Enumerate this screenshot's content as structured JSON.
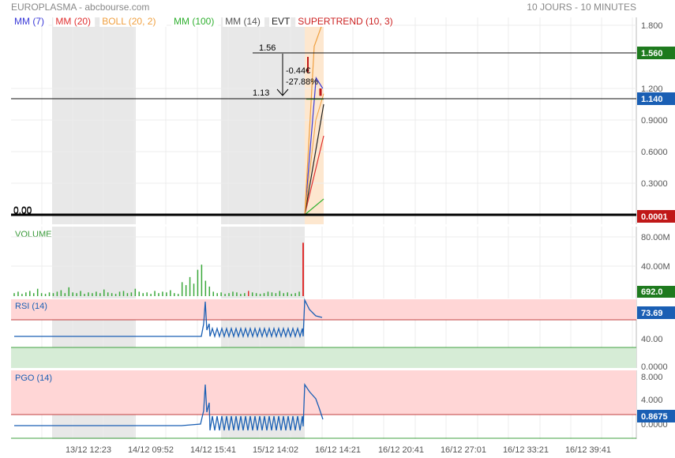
{
  "header": {
    "title": "EUROPLASMA - abcbourse.com",
    "period": "10 JOURS - 10 MINUTES"
  },
  "legend": [
    {
      "label": "MM (7)",
      "color": "#3a3ad8"
    },
    {
      "label": "MM (20)",
      "color": "#e03030"
    },
    {
      "label": "BOLL (20, 2)",
      "color": "#f0a040"
    },
    {
      "label": "MM (100)",
      "color": "#30b030"
    },
    {
      "label": "MM (14)",
      "color": "#555555"
    },
    {
      "label": "EVT",
      "color": "#222222"
    },
    {
      "label": "SUPERTREND (10, 3)",
      "color": "#cc2222"
    }
  ],
  "x_ticks": [
    "13/12 12:23",
    "14/12 09:52",
    "14/12 15:41",
    "15/12 14:02",
    "16/12 14:21",
    "16/12 20:41",
    "16/12 27:01",
    "16/12 33:21",
    "16/12 39:41"
  ],
  "price_panel": {
    "y_ticks": [
      "1.800",
      "1.200",
      "0.9000",
      "0.6000",
      "0.3000"
    ],
    "ylim": [
      0,
      1.8
    ],
    "badges": [
      {
        "label": "1.560",
        "value": 1.56,
        "color": "#1e7a1e"
      },
      {
        "label": "1.140",
        "value": 1.14,
        "color": "#1a5fb4"
      },
      {
        "label": "0.0001",
        "value": 0.0001,
        "color": "#c01818"
      }
    ],
    "annotations": {
      "high_label": "1.56",
      "low_label": "1.13",
      "change_abs": "-0.44€",
      "change_pct": "-27.88%",
      "left_zero_a": "0.00",
      "left_zero_b": "0.00"
    }
  },
  "volume_panel": {
    "label": "VOLUME",
    "y_ticks": [
      "80.00M",
      "40.00M"
    ],
    "badge": {
      "label": "692.0",
      "color": "#1e7a1e"
    }
  },
  "rsi_panel": {
    "label": "RSI (14)",
    "y_ticks": [
      "40.00",
      "0.0000"
    ],
    "badge": {
      "label": "73.69",
      "color": "#1a5fb4"
    }
  },
  "pgo_panel": {
    "label": "PGO (14)",
    "y_ticks": [
      "8.000",
      "4.000",
      "0.0000"
    ],
    "badge": {
      "label": "0.8675",
      "color": "#1a5fb4"
    }
  },
  "chart_data": {
    "type": "line",
    "title": "EUROPLASMA - abcbourse.com",
    "series": [
      {
        "name": "MM (7)",
        "color": "#3a3ad8",
        "points": [
          [
            0,
            0.0
          ],
          [
            0.6,
            1.3
          ],
          [
            0.95,
            1.2
          ]
        ]
      },
      {
        "name": "MM (20)",
        "color": "#e03030",
        "points": [
          [
            0,
            0.0
          ],
          [
            1,
            0.75
          ]
        ]
      },
      {
        "name": "MM (100)",
        "color": "#30b030",
        "points": [
          [
            0,
            0.0
          ],
          [
            1,
            0.15
          ]
        ]
      },
      {
        "name": "MM (14)",
        "color": "#222222",
        "points": [
          [
            0,
            0.0
          ],
          [
            1,
            1.05
          ]
        ]
      },
      {
        "name": "BOLL (20, 2)",
        "color": "#f0a040",
        "points": [
          [
            0,
            0.0
          ],
          [
            0.5,
            1.6
          ],
          [
            1,
            1.85
          ]
        ]
      }
    ],
    "volume": [
      3,
      5,
      2,
      4,
      6,
      3,
      9,
      3,
      2,
      4,
      3,
      5,
      7,
      3,
      11,
      4,
      3,
      6,
      2,
      4,
      3,
      5,
      3,
      8,
      4,
      3,
      2,
      5,
      6,
      3,
      4,
      9,
      5,
      3,
      4,
      2,
      6,
      3,
      5,
      4,
      7,
      3,
      2,
      18,
      14,
      25,
      16,
      35,
      42,
      20,
      12,
      5,
      3,
      4,
      2,
      3,
      5,
      4,
      2,
      3,
      6,
      4,
      3,
      2,
      3,
      5,
      4,
      3,
      6,
      3,
      4,
      2,
      3,
      5,
      72
    ],
    "rsi_level": 73.69,
    "pgo_level": 0.8675
  }
}
